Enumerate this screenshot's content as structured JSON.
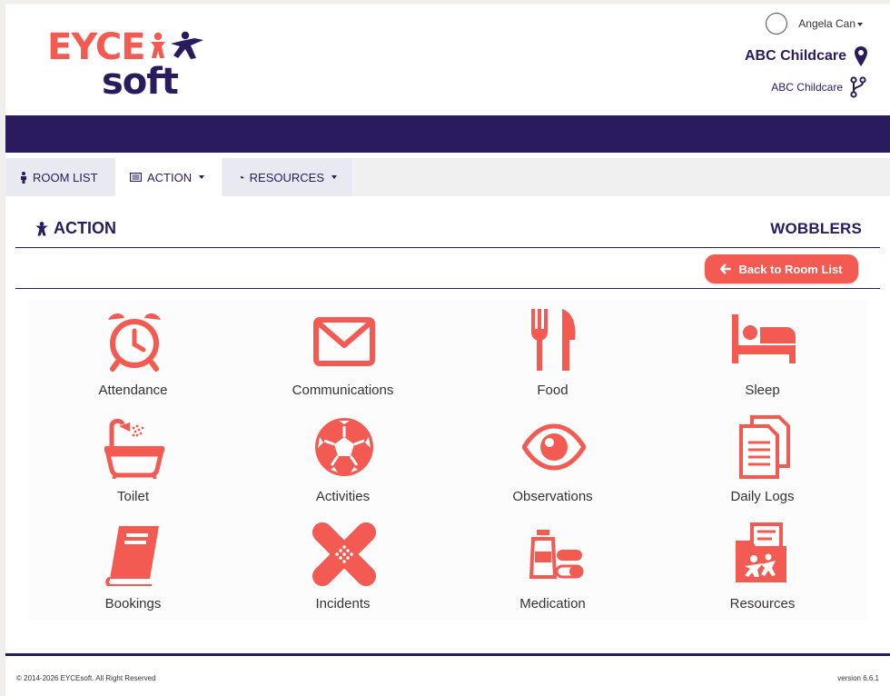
{
  "header": {
    "logo_top": "EYCE",
    "logo_bottom": "soft",
    "user_name": "Angela Can",
    "org_name": "ABC Childcare",
    "sub_org_name": "ABC Childcare"
  },
  "tabs": [
    {
      "label": "ROOM LIST",
      "icon": "person-icon",
      "active": false
    },
    {
      "label": "ACTION",
      "icon": "list-icon",
      "active": true
    },
    {
      "label": "RESOURCES",
      "icon": "folder-open-icon",
      "active": false
    }
  ],
  "panel": {
    "title": "ACTION",
    "room": "WOBBLERS",
    "back_label": "Back to Room List"
  },
  "actions": [
    {
      "label": "Attendance",
      "icon": "alarm-clock-icon"
    },
    {
      "label": "Communications",
      "icon": "envelope-icon"
    },
    {
      "label": "Food",
      "icon": "cutlery-icon"
    },
    {
      "label": "Sleep",
      "icon": "bed-icon"
    },
    {
      "label": "Toilet",
      "icon": "bathtub-icon"
    },
    {
      "label": "Activities",
      "icon": "soccer-ball-icon"
    },
    {
      "label": "Observations",
      "icon": "eye-icon"
    },
    {
      "label": "Daily Logs",
      "icon": "documents-icon"
    },
    {
      "label": "Bookings",
      "icon": "book-icon"
    },
    {
      "label": "Incidents",
      "icon": "bandage-icon"
    },
    {
      "label": "Medication",
      "icon": "medication-icon"
    },
    {
      "label": "Resources",
      "icon": "resources-folder-icon"
    }
  ],
  "footer": {
    "copyright": "© 2014-2026 EYCEsoft. All Right Reserved",
    "version": "version 6.6.1"
  },
  "colors": {
    "brand_navy": "#2a1a5e",
    "accent_coral": "#f25a52"
  }
}
